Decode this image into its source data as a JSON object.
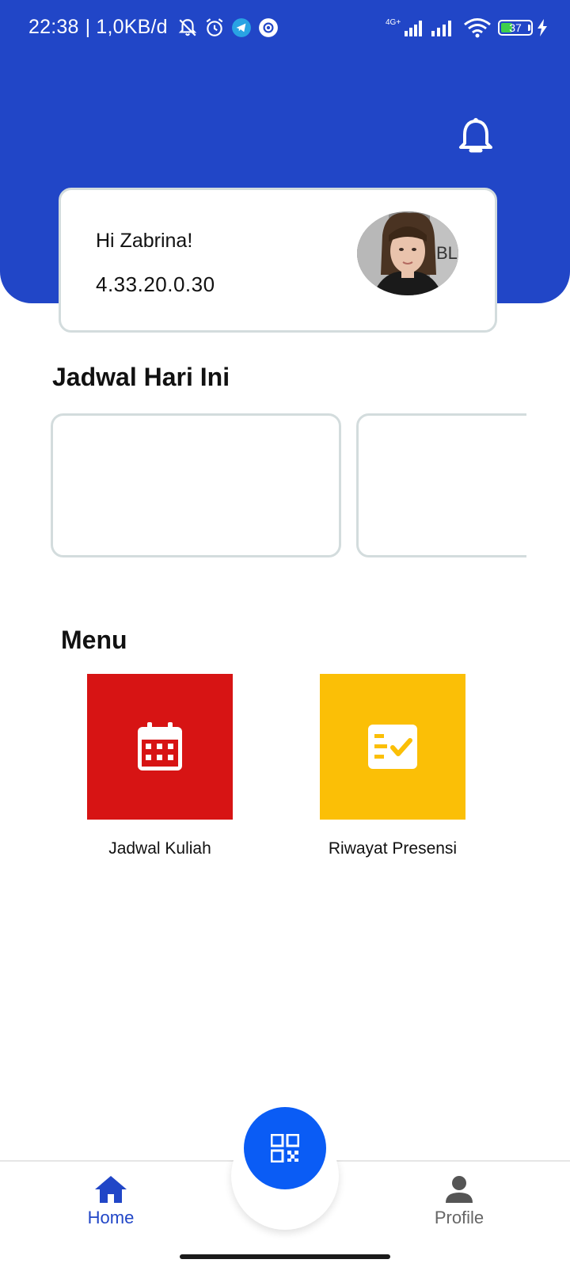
{
  "status_bar": {
    "time": "22:38",
    "speed": "| 1,0KB/d",
    "network": "4G+",
    "battery_level": "37",
    "icons_left": [
      "mute-bell-icon",
      "alarm-icon",
      "telegram-icon",
      "app-icon"
    ],
    "icons_right": [
      "signal-4g-icon",
      "signal-icon",
      "wifi-icon",
      "battery-icon",
      "charging-icon"
    ]
  },
  "header": {
    "notification_icon": "bell-icon",
    "background_color": "#2146c7"
  },
  "user_card": {
    "greeting": "Hi Zabrina!",
    "user_id": "4.33.20.0.30",
    "avatar": "user-photo"
  },
  "schedule": {
    "title": "Jadwal Hari Ini",
    "cards": [
      {},
      {}
    ]
  },
  "menu": {
    "title": "Menu",
    "items": [
      {
        "label": "Jadwal Kuliah",
        "icon": "calendar-icon",
        "color": "#d71414"
      },
      {
        "label": "Riwayat Presensi",
        "icon": "checklist-icon",
        "color": "#fbbf06"
      }
    ]
  },
  "bottom_nav": {
    "items": [
      {
        "label": "Home",
        "icon": "home-icon",
        "active": true,
        "color": "#2146c7"
      },
      {
        "label": "Profile",
        "icon": "person-icon",
        "active": false,
        "color": "#666666"
      }
    ],
    "fab_icon": "qr-code-icon",
    "fab_color": "#0a5cf5"
  }
}
